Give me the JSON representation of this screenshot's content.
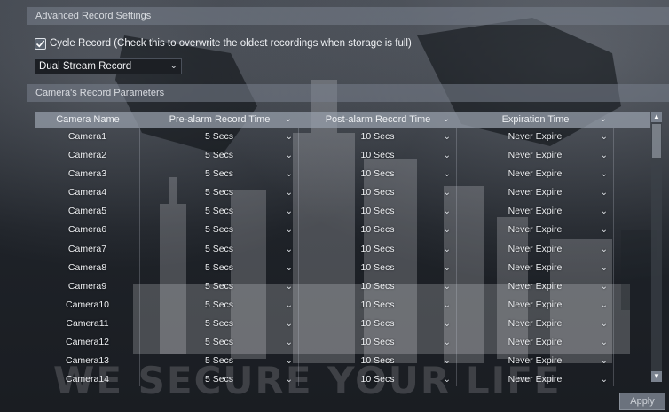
{
  "advanced_section": {
    "title": "Advanced Record Settings"
  },
  "cycle_record": {
    "checked": true,
    "label": "Cycle Record (Check this to overwrite the oldest recordings when storage is full)"
  },
  "stream_select": {
    "value": "Dual Stream Record"
  },
  "camera_section": {
    "title": "Camera's Record Parameters"
  },
  "table": {
    "headers": [
      "Camera Name",
      "Pre-alarm Record Time",
      "Post-alarm Record Time",
      "Expiration Time"
    ],
    "rows": [
      {
        "name": "Camera1",
        "pre": "5 Secs",
        "post": "10 Secs",
        "expire": "Never Expire"
      },
      {
        "name": "Camera2",
        "pre": "5 Secs",
        "post": "10 Secs",
        "expire": "Never Expire"
      },
      {
        "name": "Camera3",
        "pre": "5 Secs",
        "post": "10 Secs",
        "expire": "Never Expire"
      },
      {
        "name": "Camera4",
        "pre": "5 Secs",
        "post": "10 Secs",
        "expire": "Never Expire"
      },
      {
        "name": "Camera5",
        "pre": "5 Secs",
        "post": "10 Secs",
        "expire": "Never Expire"
      },
      {
        "name": "Camera6",
        "pre": "5 Secs",
        "post": "10 Secs",
        "expire": "Never Expire"
      },
      {
        "name": "Camera7",
        "pre": "5 Secs",
        "post": "10 Secs",
        "expire": "Never Expire"
      },
      {
        "name": "Camera8",
        "pre": "5 Secs",
        "post": "10 Secs",
        "expire": "Never Expire"
      },
      {
        "name": "Camera9",
        "pre": "5 Secs",
        "post": "10 Secs",
        "expire": "Never Expire"
      },
      {
        "name": "Camera10",
        "pre": "5 Secs",
        "post": "10 Secs",
        "expire": "Never Expire"
      },
      {
        "name": "Camera11",
        "pre": "5 Secs",
        "post": "10 Secs",
        "expire": "Never Expire"
      },
      {
        "name": "Camera12",
        "pre": "5 Secs",
        "post": "10 Secs",
        "expire": "Never Expire"
      },
      {
        "name": "Camera13",
        "pre": "5 Secs",
        "post": "10 Secs",
        "expire": "Never Expire"
      },
      {
        "name": "Camera14",
        "pre": "5 Secs",
        "post": "10 Secs",
        "expire": "Never Expire"
      }
    ]
  },
  "apply_button": {
    "label": "Apply"
  },
  "watermark": {
    "text": "WE SECURE YOUR LIFE"
  },
  "icons": {
    "checkbox": "checkmark-icon",
    "dropdown": "chevron-down-icon",
    "scroll_up": "scroll-up-icon",
    "scroll_down": "scroll-down-icon"
  }
}
